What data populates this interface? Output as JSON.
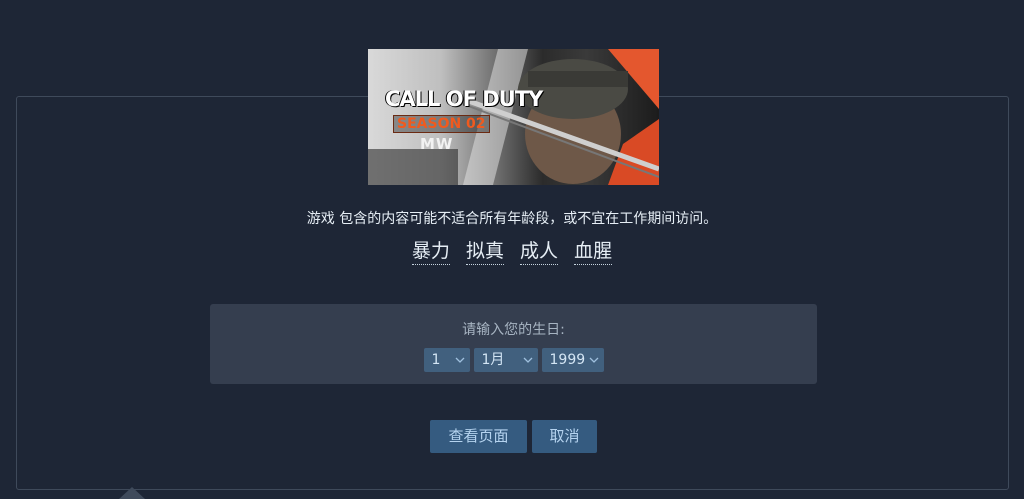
{
  "banner": {
    "title_line1": "CALL OF DUTY",
    "title_line2": "SEASON 02",
    "title_line3": "MW"
  },
  "notice": {
    "text": "游戏 包含的内容可能不适合所有年龄段，或不宜在工作期间访问。"
  },
  "descriptors": [
    "暴力",
    "拟真",
    "成人",
    "血腥"
  ],
  "dob": {
    "prompt": "请输入您的生日:",
    "day": "1",
    "month": "1月",
    "year": "1999"
  },
  "buttons": {
    "view_page": "查看页面",
    "cancel": "取消"
  },
  "colors": {
    "page_bg": "#1e2636",
    "panel_bg": "#353e4f",
    "button_bg": "#355b80",
    "select_bg": "#41607e",
    "brand_orange": "#f05a1e"
  },
  "icons": {
    "select_arrow": "chevron-down-icon"
  }
}
